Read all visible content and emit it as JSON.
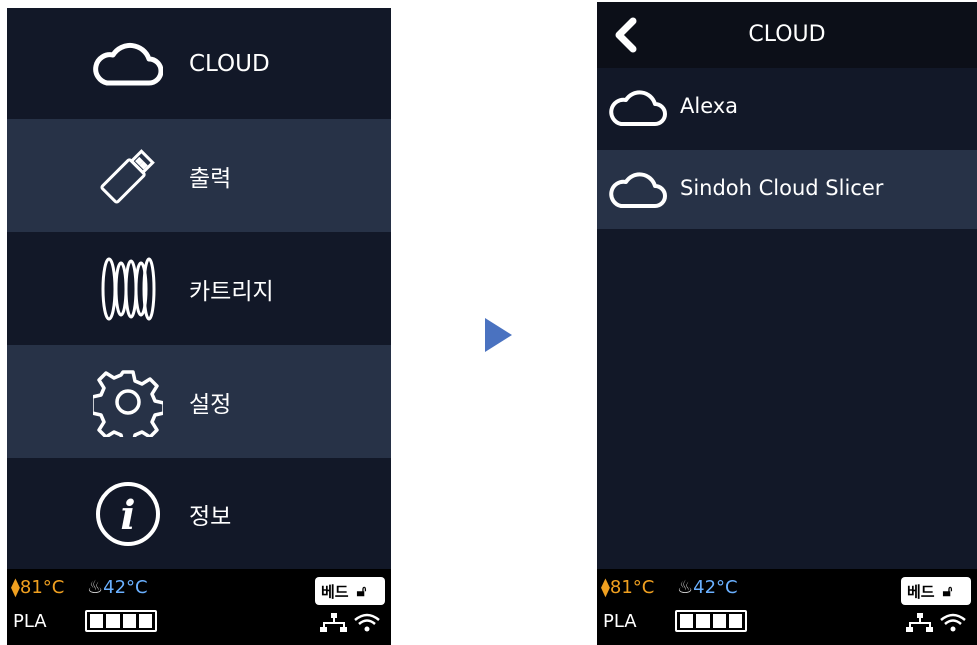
{
  "left_screen": {
    "menu": [
      {
        "label": "CLOUD",
        "icon": "cloud-icon"
      },
      {
        "label": "출력",
        "icon": "usb-stick-icon"
      },
      {
        "label": "카트리지",
        "icon": "cartridge-coil-icon"
      },
      {
        "label": "설정",
        "icon": "gear-icon"
      },
      {
        "label": "정보",
        "icon": "info-icon"
      }
    ],
    "status": {
      "nozzle_temp": "81°C",
      "bed_temp": "42°C",
      "material": "PLA",
      "bed_button": "베드"
    }
  },
  "transition_arrow": "play-arrow-icon",
  "right_screen": {
    "title": "CLOUD",
    "items": [
      {
        "label": "Alexa",
        "icon": "cloud-icon"
      },
      {
        "label": "Sindoh Cloud Slicer",
        "icon": "cloud-icon"
      }
    ],
    "status": {
      "nozzle_temp": "81°C",
      "bed_temp": "42°C",
      "material": "PLA",
      "bed_button": "베드"
    }
  },
  "colors": {
    "panel_bg": "#121828",
    "stripe": "#273247",
    "nozzle_temp": "#f0a020",
    "bed_temp": "#6ab0ff",
    "arrow": "#4a72c0"
  }
}
